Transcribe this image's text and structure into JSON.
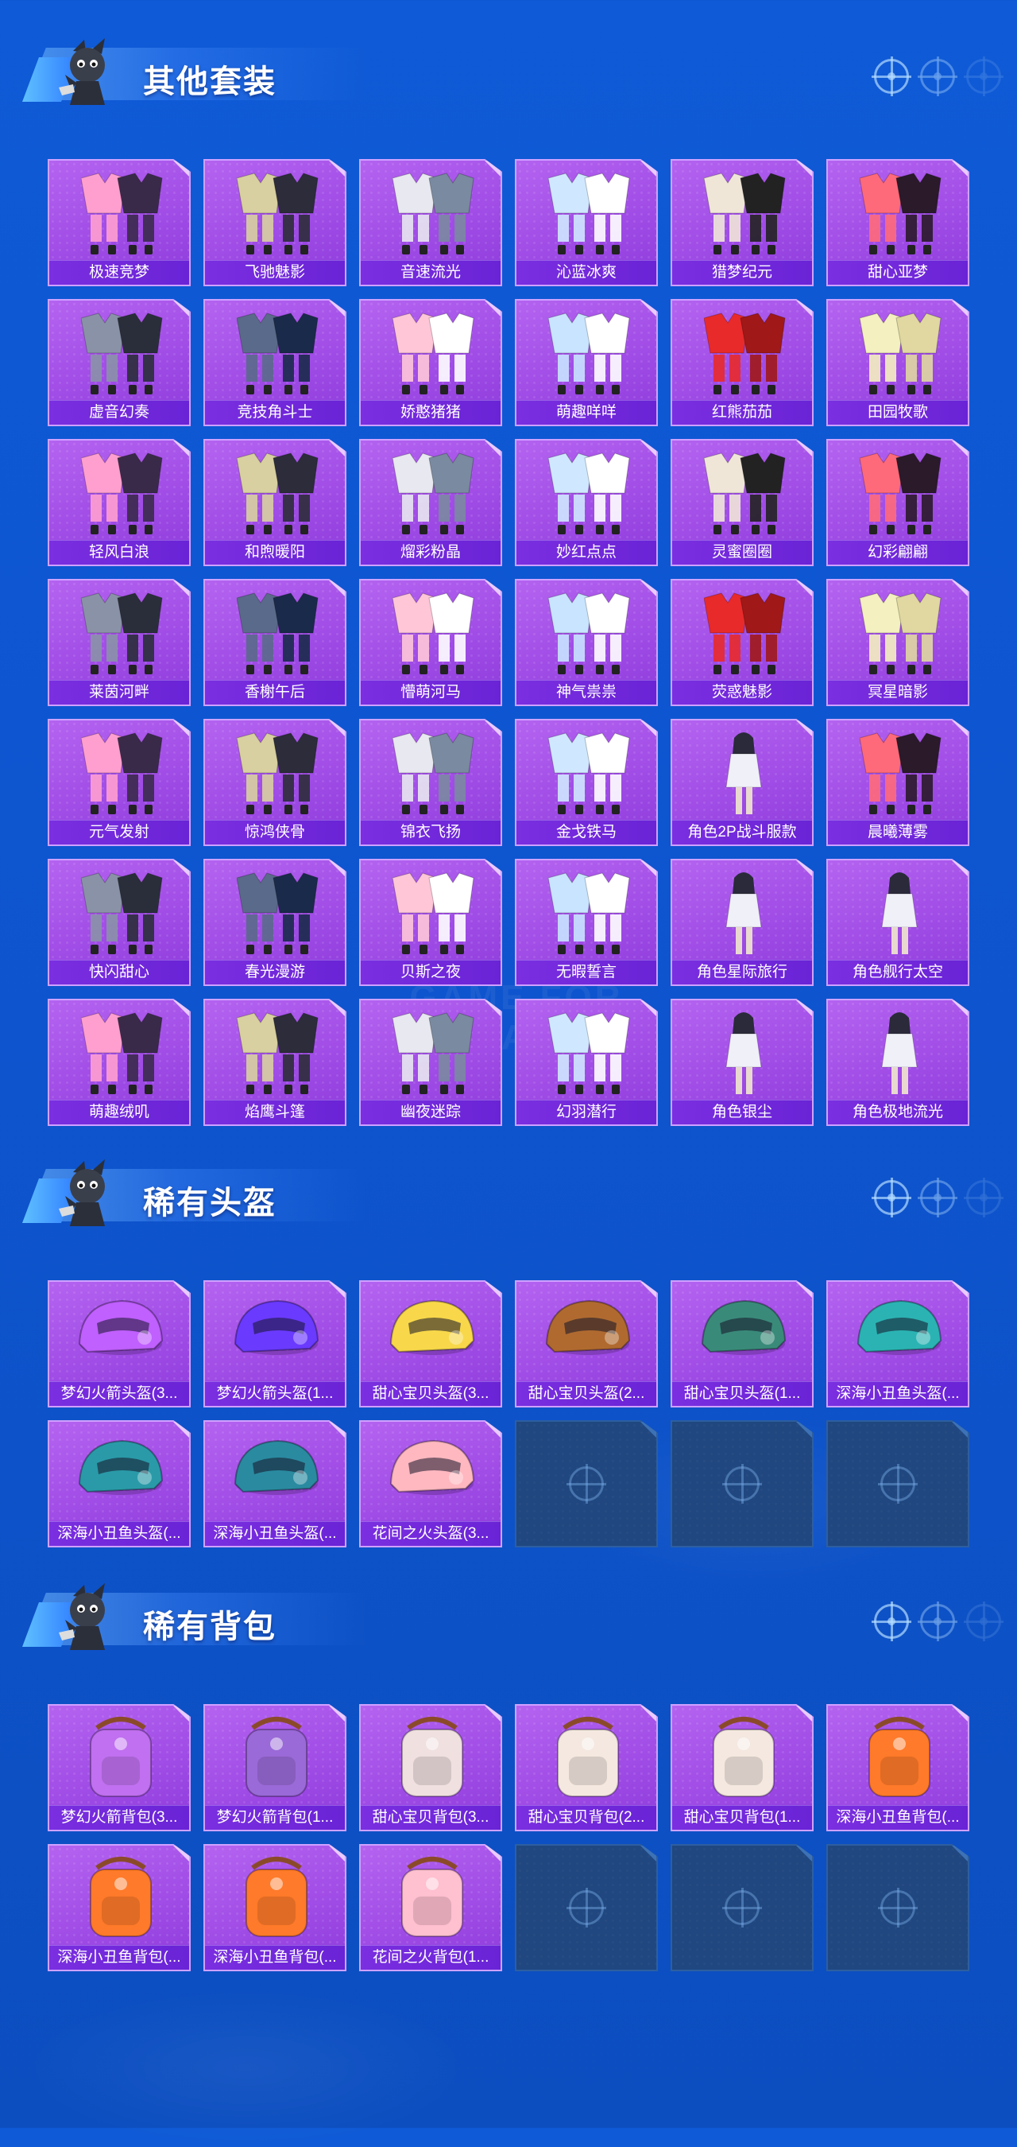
{
  "sections": {
    "outfits": {
      "title": "其他套装",
      "items": [
        "极速竞梦",
        "飞驰魅影",
        "音速流光",
        "沁蓝冰爽",
        "猎梦纪元",
        "甜心亚梦",
        "虚音幻奏",
        "竞技角斗士",
        "娇憨猪猪",
        "萌趣咩咩",
        "红熊茄茄",
        "田园牧歌",
        "轻风白浪",
        "和煦暖阳",
        "熘彩粉晶",
        "妙红点点",
        "灵蜜圈圈",
        "幻彩翩翩",
        "莱茵河畔",
        "香榭午后",
        "懵萌河马",
        "神气祟祟",
        "荧惑魅影",
        "冥星暗影",
        "元气发射",
        "惊鸿侠骨",
        "锦衣飞扬",
        "金戈铁马",
        "角色2P战斗服款",
        "晨曦薄雾",
        "快闪甜心",
        "春光漫游",
        "贝斯之夜",
        "无暇誓言",
        "角色星际旅行",
        "角色舰行太空",
        "萌趣绒叽",
        "焰鹰斗篷",
        "幽夜迷踪",
        "幻羽潜行",
        "角色银尘",
        "角色极地流光"
      ]
    },
    "helmets": {
      "title": "稀有头盔",
      "items": [
        "梦幻火箭头盔(3...",
        "梦幻火箭头盔(1...",
        "甜心宝贝头盔(3...",
        "甜心宝贝头盔(2...",
        "甜心宝贝头盔(1...",
        "深海小丑鱼头盔(...",
        "深海小丑鱼头盔(...",
        "深海小丑鱼头盔(...",
        "花间之火头盔(3..."
      ]
    },
    "backpacks": {
      "title": "稀有背包",
      "items": [
        "梦幻火箭背包(3...",
        "梦幻火箭背包(1...",
        "甜心宝贝背包(3...",
        "甜心宝贝背包(2...",
        "甜心宝贝背包(1...",
        "深海小丑鱼背包(...",
        "深海小丑鱼背包(...",
        "深海小丑鱼背包(...",
        "花间之火背包(1..."
      ]
    }
  },
  "watermark": "GAME FOR PEACE",
  "icons": {
    "section_mascot": "mascot-icon",
    "header_decor": "crosshair-icon",
    "empty_slot": "crosshair-icon"
  },
  "colors": {
    "background": "#0e55d0",
    "tile": "#a04ce6",
    "tile_label": "#7a2fe0",
    "empty_tile": "#20477f"
  }
}
